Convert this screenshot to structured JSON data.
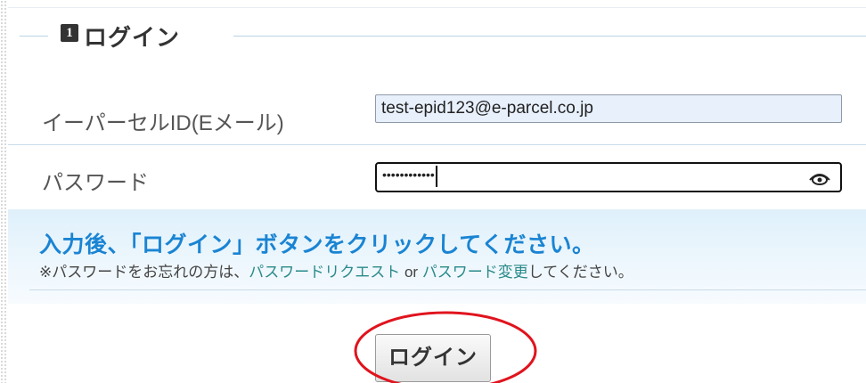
{
  "section": {
    "number": "1",
    "title": "ログイン"
  },
  "form": {
    "email_label": "イーパーセルID(Eメール)",
    "email_value": "test-epid123@e-parcel.co.jp",
    "password_label": "パスワード",
    "password_masked": "••••••••••••",
    "show_password_icon": "eye-icon"
  },
  "info": {
    "main": "入力後、「ログイン」ボタンをクリックしてください。",
    "sub_prefix": "※パスワードをお忘れの方は、",
    "link_request": "パスワードリクエスト",
    "or": " or ",
    "link_change": "パスワード変更",
    "sub_suffix": "してください。"
  },
  "buttons": {
    "login_label": "ログイン"
  },
  "colors": {
    "accent_text": "#1a84d3",
    "link": "#2a8a8a",
    "annotation": "#e0141e"
  }
}
